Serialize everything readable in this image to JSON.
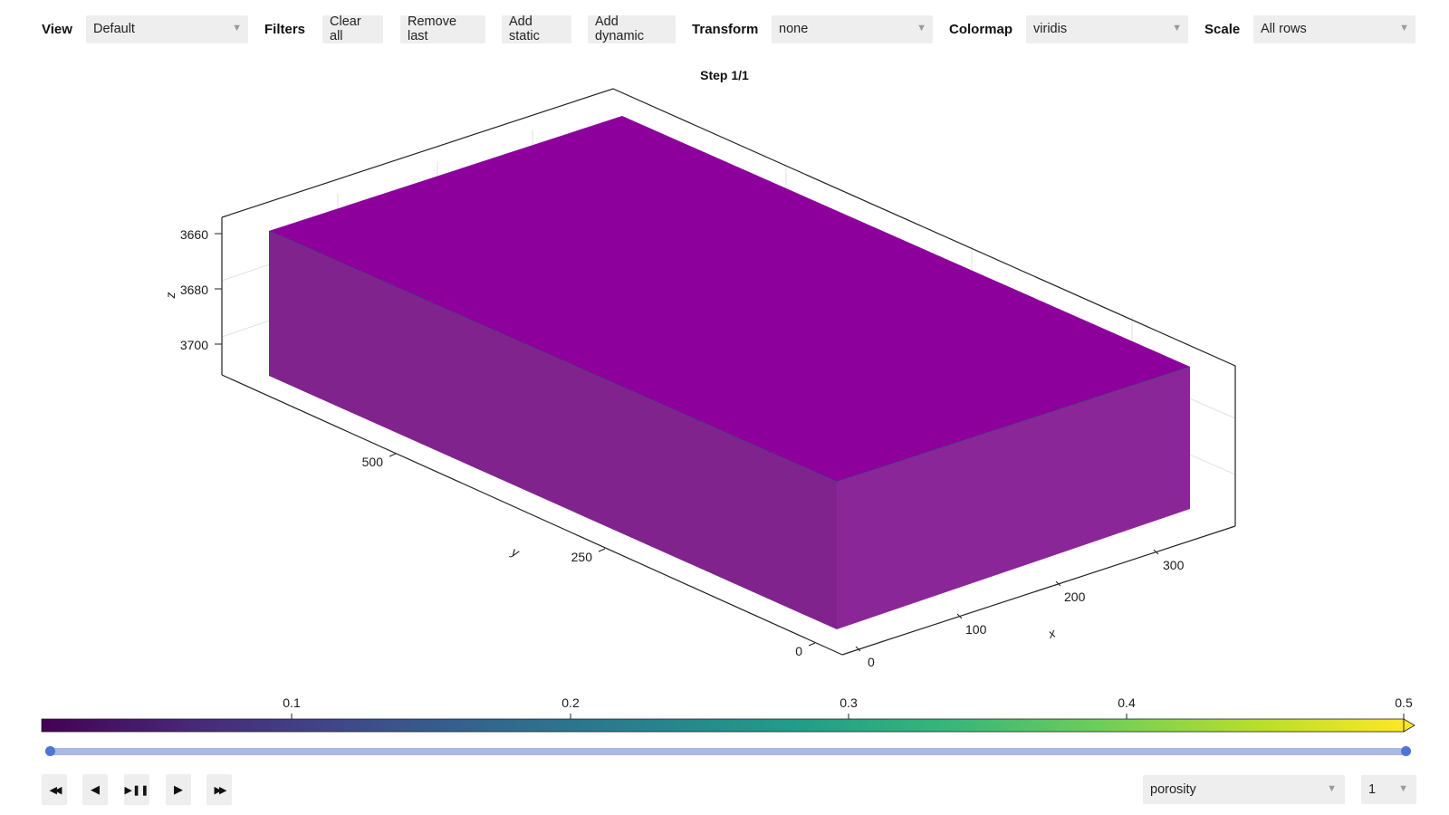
{
  "toolbar": {
    "view_label": "View",
    "view_value": "Default",
    "filters_label": "Filters",
    "clear_all": "Clear all",
    "remove_last": "Remove last",
    "add_static": "Add static",
    "add_dynamic": "Add dynamic",
    "transform_label": "Transform",
    "transform_value": "none",
    "colormap_label": "Colormap",
    "colormap_value": "viridis",
    "scale_label": "Scale",
    "scale_value": "All rows"
  },
  "plot": {
    "title": "Step 1/1",
    "axes": {
      "x": {
        "label": "x",
        "ticks": [
          "0",
          "100",
          "200",
          "300"
        ]
      },
      "y": {
        "label": "y",
        "ticks": [
          "0",
          "250",
          "500"
        ]
      },
      "z": {
        "label": "z",
        "ticks": [
          "3660",
          "3680",
          "3700"
        ]
      }
    }
  },
  "colorbar": {
    "colormap": "viridis",
    "ticks": [
      "0.1",
      "0.2",
      "0.3",
      "0.4",
      "0.5"
    ],
    "range": [
      0.01,
      0.5
    ],
    "colors": [
      "#440154",
      "#482878",
      "#3e4989",
      "#31688e",
      "#26828e",
      "#1f9e89",
      "#35b779",
      "#6ece58",
      "#b5de2b",
      "#fde725"
    ]
  },
  "timeline": {
    "range_start": 0.0,
    "range_end": 1.0
  },
  "playback": {
    "rewind_icon": "rewind-icon",
    "step_back_icon": "step-back-icon",
    "play_pause_icon": "play-pause-icon",
    "play_icon": "play-icon",
    "fast_forward_icon": "fast-forward-icon"
  },
  "property_select": {
    "value": "porosity"
  },
  "step_select": {
    "value": "1"
  }
}
